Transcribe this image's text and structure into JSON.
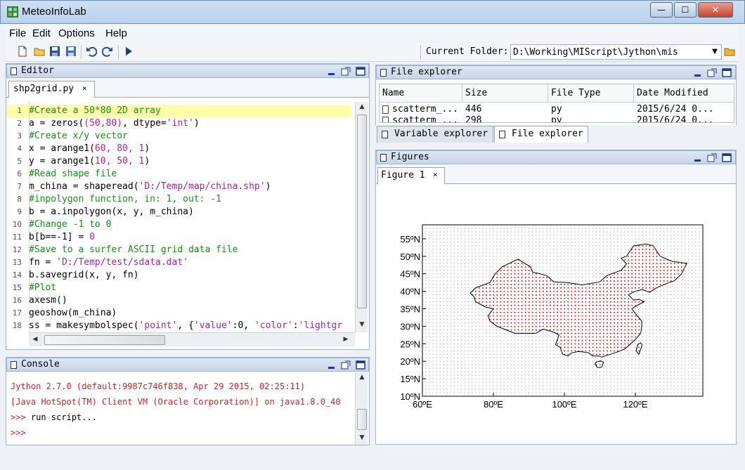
{
  "window": {
    "title": "MeteoInfoLab",
    "min_label": "—",
    "max_label": "☐",
    "close_label": "✕"
  },
  "menu": [
    "File",
    "Edit",
    "Options",
    "Help"
  ],
  "toolbar": {
    "icons": [
      "new-file-icon",
      "open-folder-icon",
      "save-icon",
      "save-all-icon",
      "undo-icon",
      "redo-icon",
      "run-icon"
    ],
    "folder_label": "Current Folder:",
    "folder_value": "D:\\Working\\MIScript\\Jython\\mis"
  },
  "editor": {
    "panel_title": "Editor",
    "tab": "shp2grid.py",
    "lines": [
      {
        "n": "1",
        "parts": [
          [
            "c",
            "#Create a 50*80 2D array"
          ]
        ]
      },
      {
        "n": "2",
        "parts": [
          [
            "t",
            "a = zeros("
          ],
          [
            "n",
            "(50,80)"
          ],
          [
            "t",
            ", dtype="
          ],
          [
            "s",
            "'int'"
          ],
          [
            "t",
            ")"
          ]
        ]
      },
      {
        "n": "3",
        "parts": [
          [
            "c",
            "#Create x/y vector"
          ]
        ]
      },
      {
        "n": "4",
        "parts": [
          [
            "t",
            "x = arange1("
          ],
          [
            "n",
            "60, 80, 1"
          ],
          [
            "t",
            ")"
          ]
        ]
      },
      {
        "n": "5",
        "parts": [
          [
            "t",
            "y = arange1("
          ],
          [
            "n",
            "10, 50, 1"
          ],
          [
            "t",
            ")"
          ]
        ]
      },
      {
        "n": "6",
        "parts": [
          [
            "c",
            "#Read shape file"
          ]
        ]
      },
      {
        "n": "7",
        "parts": [
          [
            "t",
            "m_china = shaperead("
          ],
          [
            "s",
            "'D:/Temp/map/china.shp'"
          ],
          [
            "t",
            ")"
          ]
        ]
      },
      {
        "n": "8",
        "parts": [
          [
            "c",
            "#inpolygon function, in: 1, out: -1"
          ]
        ]
      },
      {
        "n": "9",
        "parts": [
          [
            "t",
            "b = a.inpolygon(x, y, m_china)"
          ]
        ]
      },
      {
        "n": "10",
        "parts": [
          [
            "c",
            "#Change -1 to 0"
          ]
        ]
      },
      {
        "n": "11",
        "parts": [
          [
            "t",
            "b[b==-1] = "
          ],
          [
            "n",
            "0"
          ]
        ]
      },
      {
        "n": "12",
        "parts": [
          [
            "c",
            "#Save to a surfer ASCII grid data file"
          ]
        ]
      },
      {
        "n": "13",
        "parts": [
          [
            "t",
            "fn = "
          ],
          [
            "s",
            "'D:/Temp/test/sdata.dat'"
          ]
        ]
      },
      {
        "n": "14",
        "parts": [
          [
            "t",
            "b.savegrid(x, y, fn)"
          ]
        ]
      },
      {
        "n": "15",
        "parts": [
          [
            "c",
            "#Plot"
          ]
        ]
      },
      {
        "n": "16",
        "parts": [
          [
            "t",
            "axesm()"
          ]
        ]
      },
      {
        "n": "17",
        "parts": [
          [
            "t",
            "geoshow(m_china)"
          ]
        ]
      },
      {
        "n": "18",
        "parts": [
          [
            "t",
            "ss = makesymbolspec("
          ],
          [
            "s",
            "'point'"
          ],
          [
            "t",
            ", {"
          ],
          [
            "s",
            "'value'"
          ],
          [
            "t",
            ":0, "
          ],
          [
            "s",
            "'color'"
          ],
          [
            "t",
            ":"
          ],
          [
            "s",
            "'lightgr"
          ]
        ]
      }
    ]
  },
  "console": {
    "panel_title": "Console",
    "lines": [
      {
        "k": false,
        "text": "Jython 2.7.0 (default:9987c746f838, Apr 29 2015, 02:25:11)"
      },
      {
        "k": false,
        "text": "[Java HotSpot(TM) Client VM (Oracle Corporation)] on java1.8.0_40"
      },
      {
        "k": true,
        "prompt": ">>> ",
        "text": "run script..."
      },
      {
        "k": false,
        "text": ">>>"
      }
    ]
  },
  "file_explorer": {
    "panel_title": "File explorer",
    "columns": [
      "Name",
      "Size",
      "File Type",
      "Date Modified"
    ],
    "rows": [
      {
        "name": "scatterm_...",
        "size": "446",
        "type": "py",
        "date": "2015/6/24 0..."
      },
      {
        "name": "scatterm_...",
        "size": "298",
        "type": "py",
        "date": "2015/6/24 0..."
      }
    ],
    "tabs": [
      "Variable explorer",
      "File explorer"
    ]
  },
  "figures": {
    "panel_title": "Figures",
    "tab": "Figure 1"
  },
  "chart_data": {
    "type": "map",
    "x_ticks": [
      "60ºE",
      "80ºE",
      "100ºE",
      "120ºE"
    ],
    "x_values": [
      60,
      80,
      100,
      120
    ],
    "y_ticks": [
      "10ºN",
      "15ºN",
      "20ºN",
      "25ºN",
      "30ºN",
      "35ºN",
      "40ºN",
      "45ºN",
      "50ºN",
      "55ºN"
    ],
    "y_values": [
      10,
      15,
      20,
      25,
      30,
      35,
      40,
      45,
      50,
      55
    ],
    "xlim": [
      60,
      139
    ],
    "ylim": [
      10,
      59
    ],
    "outside_color": "#b0b0b0",
    "inside_color": "#cc0000",
    "grid_step": 1,
    "china_outline": [
      [
        73.5,
        39.5
      ],
      [
        75,
        41
      ],
      [
        79,
        42.5
      ],
      [
        80.5,
        45
      ],
      [
        82.5,
        47
      ],
      [
        85.5,
        48.5
      ],
      [
        87,
        49.2
      ],
      [
        88,
        48.5
      ],
      [
        90.5,
        47
      ],
      [
        91,
        45.5
      ],
      [
        95,
        44.5
      ],
      [
        97,
        42.7
      ],
      [
        101,
        42.5
      ],
      [
        105,
        41.8
      ],
      [
        110,
        42.7
      ],
      [
        112,
        44.5
      ],
      [
        116,
        46
      ],
      [
        117.5,
        47.8
      ],
      [
        116,
        49.5
      ],
      [
        117.5,
        50
      ],
      [
        119.5,
        53
      ],
      [
        123,
        53.5
      ],
      [
        125,
        53
      ],
      [
        127,
        50
      ],
      [
        130.5,
        48.5
      ],
      [
        134.5,
        48
      ],
      [
        133,
        45
      ],
      [
        131,
        43
      ],
      [
        129.5,
        42.5
      ],
      [
        126,
        41
      ],
      [
        124,
        39.7
      ],
      [
        122,
        40.5
      ],
      [
        120,
        40
      ],
      [
        118,
        39
      ],
      [
        119.5,
        37.5
      ],
      [
        121,
        37.7
      ],
      [
        122.5,
        37
      ],
      [
        120.5,
        36
      ],
      [
        119,
        35
      ],
      [
        120.5,
        33
      ],
      [
        121.8,
        31.5
      ],
      [
        121.8,
        30
      ],
      [
        121.5,
        28
      ],
      [
        119.8,
        26
      ],
      [
        117,
        23.5
      ],
      [
        115,
        22.7
      ],
      [
        113,
        22
      ],
      [
        110.5,
        21.2
      ],
      [
        109.7,
        21.5
      ],
      [
        108,
        21.5
      ],
      [
        106.7,
        22.5
      ],
      [
        104,
        22.8
      ],
      [
        102,
        22.4
      ],
      [
        101,
        21.5
      ],
      [
        99.5,
        22
      ],
      [
        98.8,
        24
      ],
      [
        97.5,
        24.8
      ],
      [
        98.5,
        27.5
      ],
      [
        97,
        28.3
      ],
      [
        94,
        29.2
      ],
      [
        92,
        28
      ],
      [
        89,
        28
      ],
      [
        86,
        28
      ],
      [
        84,
        28.8
      ],
      [
        81,
        30
      ],
      [
        79,
        31.5
      ],
      [
        78.5,
        33
      ],
      [
        80,
        35
      ],
      [
        77.8,
        35.5
      ],
      [
        75,
        37
      ],
      [
        74.5,
        38.5
      ]
    ],
    "hainan_outline": [
      [
        108.6,
        19.2
      ],
      [
        109.3,
        18.2
      ],
      [
        110.5,
        18.3
      ],
      [
        111,
        19.7
      ],
      [
        110.2,
        20.1
      ],
      [
        109,
        19.8
      ]
    ],
    "taiwan_outline": [
      [
        120.2,
        23
      ],
      [
        121,
        22
      ],
      [
        121.9,
        24.6
      ],
      [
        121.5,
        25.3
      ],
      [
        120.7,
        24.8
      ]
    ]
  }
}
